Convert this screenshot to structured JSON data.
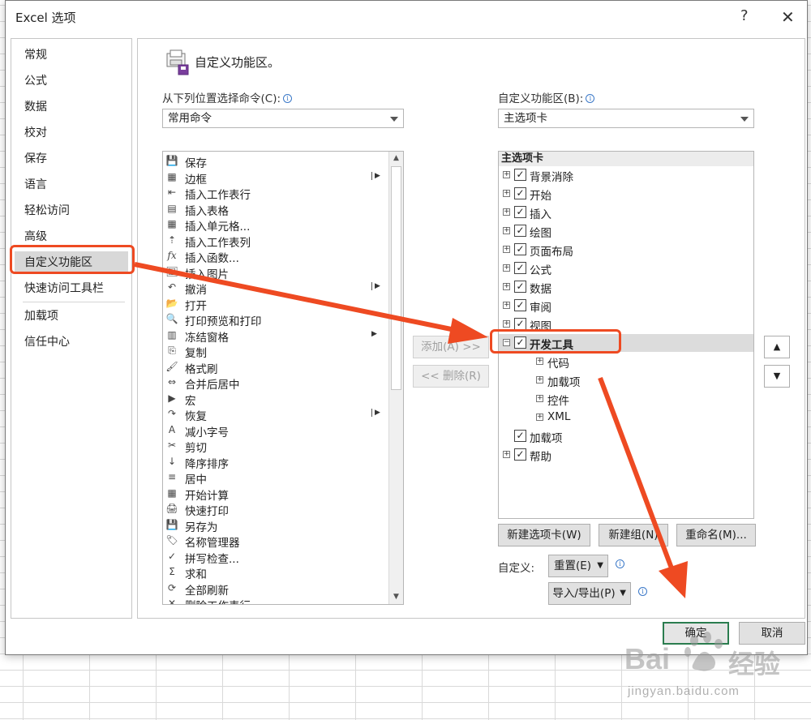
{
  "dialog": {
    "title": "Excel 选项",
    "help": "?",
    "close": "✕"
  },
  "nav": {
    "items": [
      {
        "label": "常规"
      },
      {
        "label": "公式"
      },
      {
        "label": "数据"
      },
      {
        "label": "校对"
      },
      {
        "label": "保存"
      },
      {
        "label": "语言"
      },
      {
        "label": "轻松访问"
      },
      {
        "label": "高级"
      },
      {
        "label": "自定义功能区"
      },
      {
        "label": "快速访问工具栏"
      },
      {
        "label": "加载项"
      },
      {
        "label": "信任中心"
      }
    ],
    "selected": "自定义功能区"
  },
  "main": {
    "section_title": "自定义功能区。",
    "choose_from_label": "从下列位置选择命令(C):",
    "choose_from_value": "常用命令",
    "customize_label": "自定义功能区(B):",
    "customize_value": "主选项卡"
  },
  "commands": [
    {
      "label": "保存",
      "icon": "💾",
      "sub": ""
    },
    {
      "label": "边框",
      "icon": "▦",
      "sub": "bar"
    },
    {
      "label": "插入工作表行",
      "icon": "⇤",
      "sub": ""
    },
    {
      "label": "插入表格",
      "icon": "▤",
      "sub": ""
    },
    {
      "label": "插入单元格...",
      "icon": "▦",
      "sub": ""
    },
    {
      "label": "插入工作表列",
      "icon": "⇡",
      "sub": ""
    },
    {
      "label": "插入函数...",
      "icon": "fx",
      "sub": ""
    },
    {
      "label": "插入图片",
      "icon": "🖼",
      "sub": ""
    },
    {
      "label": "撤消",
      "icon": "↶",
      "sub": "bar"
    },
    {
      "label": "打开",
      "icon": "📂",
      "sub": ""
    },
    {
      "label": "打印预览和打印",
      "icon": "🔍",
      "sub": ""
    },
    {
      "label": "冻结窗格",
      "icon": "▥",
      "sub": "arrow"
    },
    {
      "label": "复制",
      "icon": "⎘",
      "sub": ""
    },
    {
      "label": "格式刷",
      "icon": "🖌",
      "sub": ""
    },
    {
      "label": "合并后居中",
      "icon": "⇔",
      "sub": ""
    },
    {
      "label": "宏",
      "icon": "▶",
      "sub": ""
    },
    {
      "label": "恢复",
      "icon": "↷",
      "sub": "bar"
    },
    {
      "label": "减小字号",
      "icon": "A",
      "sub": ""
    },
    {
      "label": "剪切",
      "icon": "✂",
      "sub": ""
    },
    {
      "label": "降序排序",
      "icon": "↓",
      "sub": ""
    },
    {
      "label": "居中",
      "icon": "≡",
      "sub": ""
    },
    {
      "label": "开始计算",
      "icon": "▦",
      "sub": ""
    },
    {
      "label": "快速打印",
      "icon": "🖨",
      "sub": ""
    },
    {
      "label": "另存为",
      "icon": "💾",
      "sub": ""
    },
    {
      "label": "名称管理器",
      "icon": "🏷",
      "sub": ""
    },
    {
      "label": "拼写检查...",
      "icon": "✓",
      "sub": ""
    },
    {
      "label": "求和",
      "icon": "Σ",
      "sub": ""
    },
    {
      "label": "全部刷新",
      "icon": "⟳",
      "sub": ""
    },
    {
      "label": "删除工作表行",
      "icon": "✕",
      "sub": ""
    }
  ],
  "middle_buttons": {
    "add": "添加(A) >>",
    "remove": "<< 删除(R)"
  },
  "tree": {
    "header": "主选项卡",
    "items": [
      {
        "label": "背景消除",
        "level": 0,
        "expander": "+",
        "checked": true
      },
      {
        "label": "开始",
        "level": 0,
        "expander": "+",
        "checked": true
      },
      {
        "label": "插入",
        "level": 0,
        "expander": "+",
        "checked": true
      },
      {
        "label": "绘图",
        "level": 0,
        "expander": "+",
        "checked": true
      },
      {
        "label": "页面布局",
        "level": 0,
        "expander": "+",
        "checked": true
      },
      {
        "label": "公式",
        "level": 0,
        "expander": "+",
        "checked": true
      },
      {
        "label": "数据",
        "level": 0,
        "expander": "+",
        "checked": true
      },
      {
        "label": "审阅",
        "level": 0,
        "expander": "+",
        "checked": true
      },
      {
        "label": "视图",
        "level": 0,
        "expander": "+",
        "checked": true
      },
      {
        "label": "开发工具",
        "level": 0,
        "expander": "−",
        "checked": true,
        "highlight": true
      },
      {
        "label": "代码",
        "level": 1,
        "expander": "+",
        "checked": null
      },
      {
        "label": "加载项",
        "level": 1,
        "expander": "+",
        "checked": null
      },
      {
        "label": "控件",
        "level": 1,
        "expander": "+",
        "checked": null
      },
      {
        "label": "XML",
        "level": 1,
        "expander": "+",
        "checked": null
      },
      {
        "label": "加载项",
        "level": 0,
        "expander": "",
        "checked": true
      },
      {
        "label": "帮助",
        "level": 0,
        "expander": "+",
        "checked": true
      }
    ]
  },
  "tree_buttons": {
    "new_tab": "新建选项卡(W)",
    "new_group": "新建组(N)",
    "rename": "重命名(M)..."
  },
  "customizations": {
    "label": "自定义:",
    "reset": "重置(E)",
    "import_export": "导入/导出(P)"
  },
  "footer": {
    "ok": "确定",
    "cancel": "取消"
  },
  "watermark": {
    "brand": "Bai",
    "brand2": "经验",
    "url": "jingyan.baidu.com"
  },
  "colors": {
    "annotation": "#ee4a22",
    "primary_border": "#2b7d4f"
  }
}
